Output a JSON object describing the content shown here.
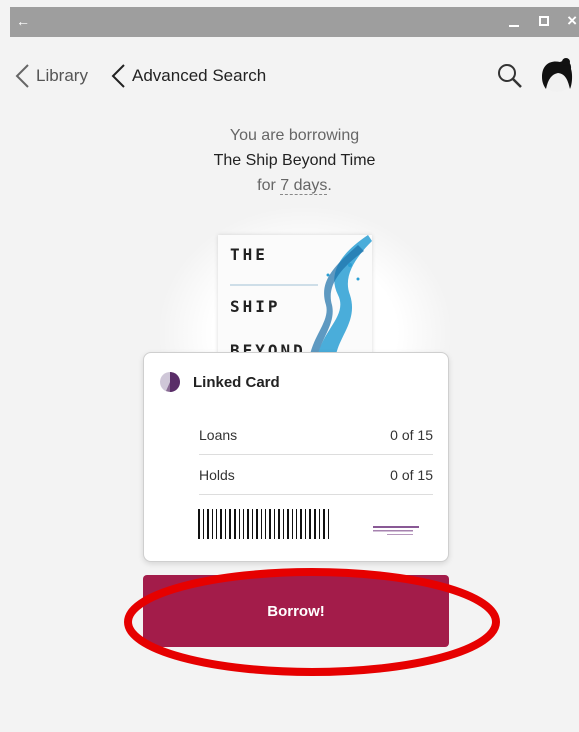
{
  "titlebar": {
    "back_glyph": "←",
    "close_glyph": "×"
  },
  "nav": {
    "library_label": "Library",
    "advanced_search_label": "Advanced Search"
  },
  "borrow_message": {
    "line1": "You are borrowing",
    "title": "The Ship Beyond Time",
    "for_prefix": "for ",
    "duration": "7 days",
    "suffix": "."
  },
  "cover": {
    "word1": "THE",
    "word2": "SHIP",
    "word3": "BEYOND"
  },
  "card": {
    "name": "Linked Card",
    "loans_label": "Loans",
    "loans_value": "0 of 15",
    "holds_label": "Holds",
    "holds_value": "0 of 15"
  },
  "borrow_button_label": "Borrow!",
  "colors": {
    "accent": "#a31c4a",
    "highlight": "#e60000",
    "titlebar": "#9e9e9e"
  },
  "icons": [
    "back-arrow-icon",
    "minimize-icon",
    "maximize-icon",
    "close-icon",
    "chevron-left-icon",
    "search-icon",
    "avatar-icon",
    "card-icon",
    "barcode-icon"
  ]
}
